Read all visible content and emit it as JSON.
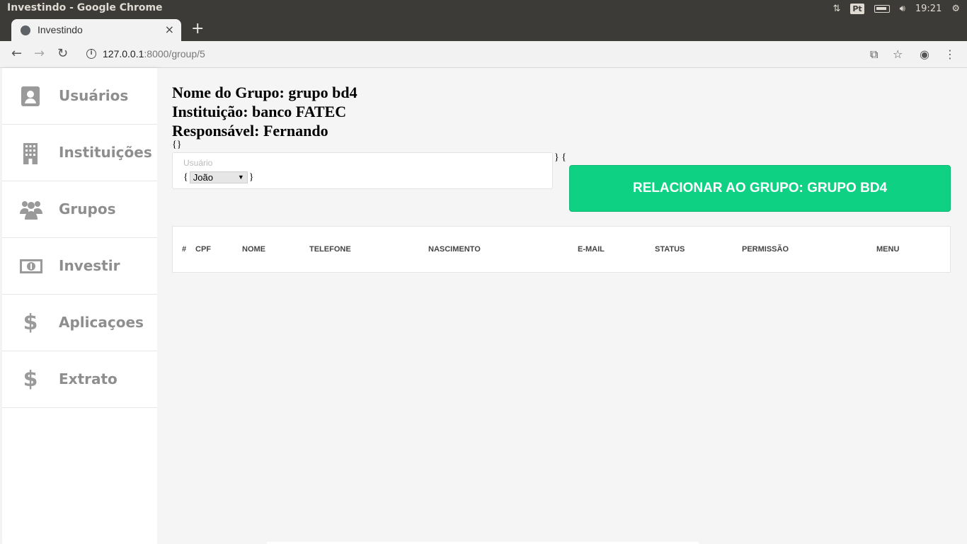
{
  "os": {
    "window_title": "Investindo - Google Chrome",
    "keyboard_indicator": "Pt",
    "clock": "19:21"
  },
  "browser": {
    "tab_title": "Investindo",
    "tab_close": "×",
    "new_tab": "+",
    "url_host": "127.0.0.1",
    "url_path": ":8000/group/5"
  },
  "sidebar": {
    "items": [
      {
        "label": "Usuários",
        "icon": "address-book-icon"
      },
      {
        "label": "Instituições",
        "icon": "building-icon"
      },
      {
        "label": "Grupos",
        "icon": "users-icon"
      },
      {
        "label": "Investir",
        "icon": "money-bill-icon"
      },
      {
        "label": "Aplicaçoes",
        "icon": "dollar-icon"
      },
      {
        "label": "Extrato",
        "icon": "dollar-icon"
      }
    ]
  },
  "group": {
    "name_line": "Nome do Grupo: grupo bd4",
    "institution_line": "Instituição: banco FATEC",
    "responsible_line": "Responsável: Fernando",
    "raw_braces_top": "{}",
    "raw_braces_mid": "} {",
    "brace_open": "{",
    "brace_close": "}"
  },
  "form": {
    "user_placeholder": "Usuário",
    "selected_user": "João",
    "submit_label": "RELACIONAR AO GRUPO: GRUPO BD4"
  },
  "table": {
    "columns": [
      "#",
      "CPF",
      "NOME",
      "TELEFONE",
      "NASCIMENTO",
      "E-MAIL",
      "STATUS",
      "PERMISSÃO",
      "MENU"
    ]
  }
}
